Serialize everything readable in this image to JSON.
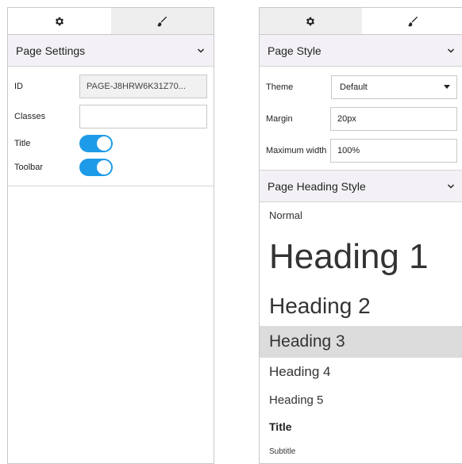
{
  "left": {
    "section_title": "Page Settings",
    "fields": {
      "id_label": "ID",
      "id_value": "PAGE-J8HRW6K31Z70...",
      "classes_label": "Classes",
      "classes_value": "",
      "title_label": "Title",
      "title_toggle_on": true,
      "toolbar_label": "Toolbar",
      "toolbar_toggle_on": true
    }
  },
  "right": {
    "section_title": "Page Style",
    "fields": {
      "theme_label": "Theme",
      "theme_value": "Default",
      "margin_label": "Margin",
      "margin_value": "20px",
      "max_width_label": "Maximum width",
      "max_width_value": "100%"
    },
    "heading_section_title": "Page Heading Style",
    "headings": [
      {
        "label": "Normal"
      },
      {
        "label": "Heading 1"
      },
      {
        "label": "Heading 2"
      },
      {
        "label": "Heading 3",
        "selected": true
      },
      {
        "label": "Heading 4"
      },
      {
        "label": "Heading 5"
      },
      {
        "label": "Title"
      },
      {
        "label": "Subtitle"
      }
    ]
  },
  "tabs": {
    "settings_icon": "gear-icon",
    "style_icon": "brush-icon"
  },
  "colors": {
    "accent": "#1e9be8",
    "header_bg": "#f3f1f6",
    "tab_inactive_bg": "#eeeeee",
    "selected_bg": "#dcdcdc"
  }
}
